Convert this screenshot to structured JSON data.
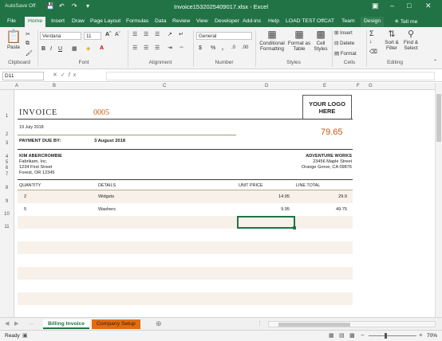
{
  "window": {
    "autosave_label": "AutoSave",
    "autosave_state": "Off",
    "title": "Invoice1532025409017.xlsx  -  Excel",
    "accent_color": "#217346"
  },
  "tabs": [
    "File",
    "Home",
    "Insert",
    "Draw",
    "Page Layout",
    "Formulas",
    "Data",
    "Review",
    "View",
    "Developer",
    "Add-ins",
    "Help",
    "LOAD TEST",
    "OffCAT",
    "Team",
    "Design"
  ],
  "tell_me": "Tell me",
  "ribbon": {
    "clipboard": {
      "paste": "Paste",
      "label": "Clipboard"
    },
    "font": {
      "name": "Verdana",
      "size": "11",
      "label": "Font"
    },
    "alignment": {
      "label": "Alignment"
    },
    "number": {
      "format": "General",
      "label": "Number"
    },
    "styles": {
      "conditional_1": "Conditional",
      "conditional_2": "Formatting",
      "format_as_1": "Format as",
      "format_as_2": "Table",
      "cell_1": "Cell",
      "cell_2": "Styles",
      "label": "Styles"
    },
    "cells": {
      "insert": "Insert",
      "delete": "Delete",
      "format": "Format",
      "label": "Cells"
    },
    "editing": {
      "sort_1": "Sort &",
      "sort_2": "Filter",
      "find_1": "Find &",
      "find_2": "Select",
      "label": "Editing"
    }
  },
  "formula_bar": {
    "name_box": "D11",
    "formula": ""
  },
  "columns": [
    "A",
    "B",
    "C",
    "D",
    "E",
    "F",
    "G"
  ],
  "rows": [
    "1",
    "2",
    "3",
    "4",
    "5",
    "6",
    "7",
    "8",
    "9",
    "10",
    "11"
  ],
  "invoice": {
    "title": "INVOICE",
    "number": "0005",
    "logo_line1": "YOUR LOGO",
    "logo_line2": "HERE",
    "date": "19 July 2018",
    "total": "79.65",
    "payment_due_label": "PAYMENT DUE BY:",
    "payment_due_date": "3 August 2018",
    "bill_to": [
      "KIM ABERCROMBIE",
      "Fabrikam, Inc.",
      "1234 First Street",
      "Forest, OR 12345"
    ],
    "from": [
      "ADVENTURE WORKS",
      "23456 Maple Street",
      "Orange Grove, CA 09876"
    ],
    "headers": {
      "quantity": "QUANTITY",
      "details": "DETAILS",
      "unit_price": "UNIT PRICE",
      "line_total": "LINE TOTAL"
    },
    "items": [
      {
        "quantity": "2",
        "details": "Widgets",
        "unit_price": "14.95",
        "line_total": "29.9"
      },
      {
        "quantity": "5",
        "details": "Washers",
        "unit_price": "9.95",
        "line_total": "49.75"
      }
    ]
  },
  "sheet_tabs": {
    "active": "Billing Invoice",
    "other": "Company Setup"
  },
  "status": {
    "ready": "Ready",
    "zoom": "70%"
  }
}
